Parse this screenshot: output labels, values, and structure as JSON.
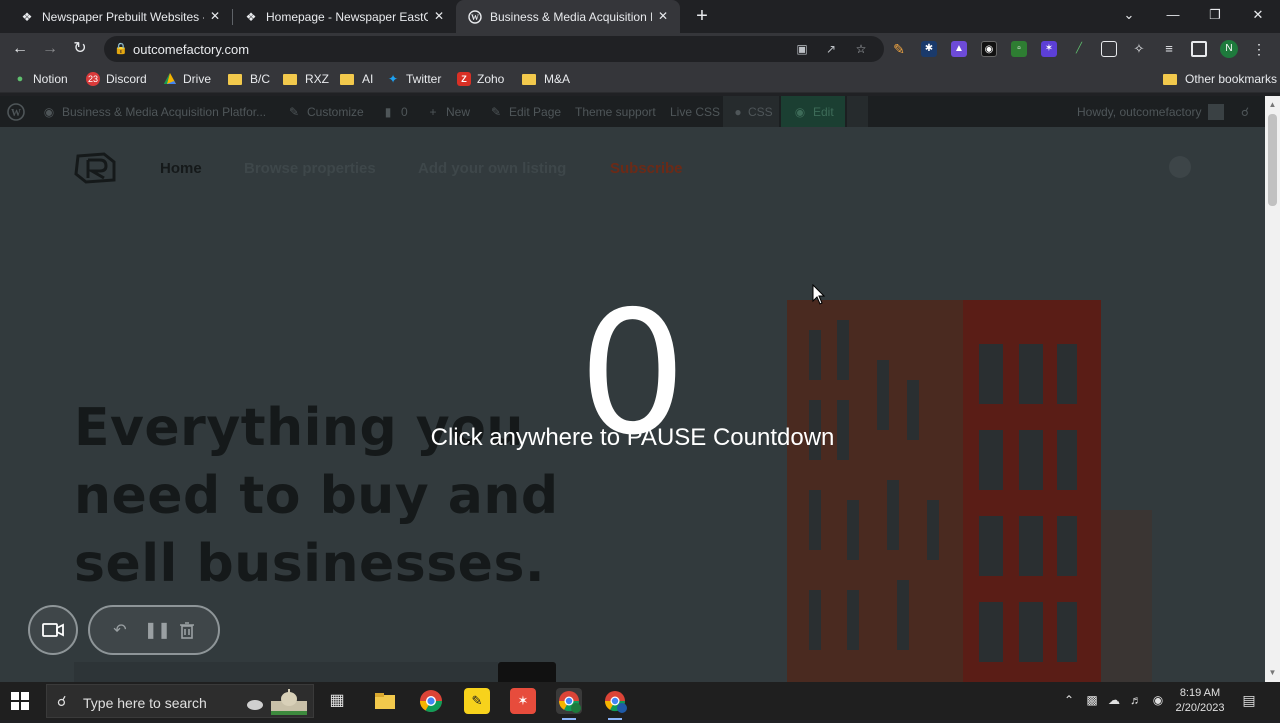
{
  "browser": {
    "tabs": [
      {
        "title": "Newspaper Prebuilt Websites - N",
        "icon": "newspaper-icon"
      },
      {
        "title": "Homepage - Newspaper EastCoa",
        "icon": "newspaper-icon"
      },
      {
        "title": "Business & Media Acquisition Pla",
        "icon": "wordpress-icon",
        "active": true
      }
    ],
    "url": "outcomefactory.com",
    "profile_initial": "N",
    "bookmarks": [
      "Notion",
      "Discord",
      "Drive",
      "B/C",
      "RXZ",
      "AI",
      "Twitter",
      "Zoho",
      "M&A"
    ],
    "other_bookmarks": "Other bookmarks",
    "discord_badge": "23"
  },
  "admin_bar": {
    "site_title": "Business & Media Acquisition Platfor...",
    "customize": "Customize",
    "comments_count": "0",
    "new": "New",
    "edit_page": "Edit Page",
    "theme_support": "Theme support",
    "live_css": "Live CSS",
    "css": "CSS",
    "edit": "Edit",
    "howdy": "Howdy, outcomefactory"
  },
  "site": {
    "nav": {
      "home": "Home",
      "browse": "Browse properties",
      "add_listing": "Add your own listing",
      "subscribe": "Subscribe"
    },
    "headline_lines": [
      "Everything you",
      "need to buy and",
      "sell businesses."
    ]
  },
  "overlay": {
    "countdown": "0",
    "message": "Click anywhere to PAUSE Countdown"
  },
  "taskbar": {
    "search_placeholder": "Type here to search",
    "time": "8:19 AM",
    "date": "2/20/2023"
  },
  "colors": {
    "accent_edit": "#1b3f32",
    "subscribe": "#6b2a17",
    "profile": "#1e7a3c"
  }
}
